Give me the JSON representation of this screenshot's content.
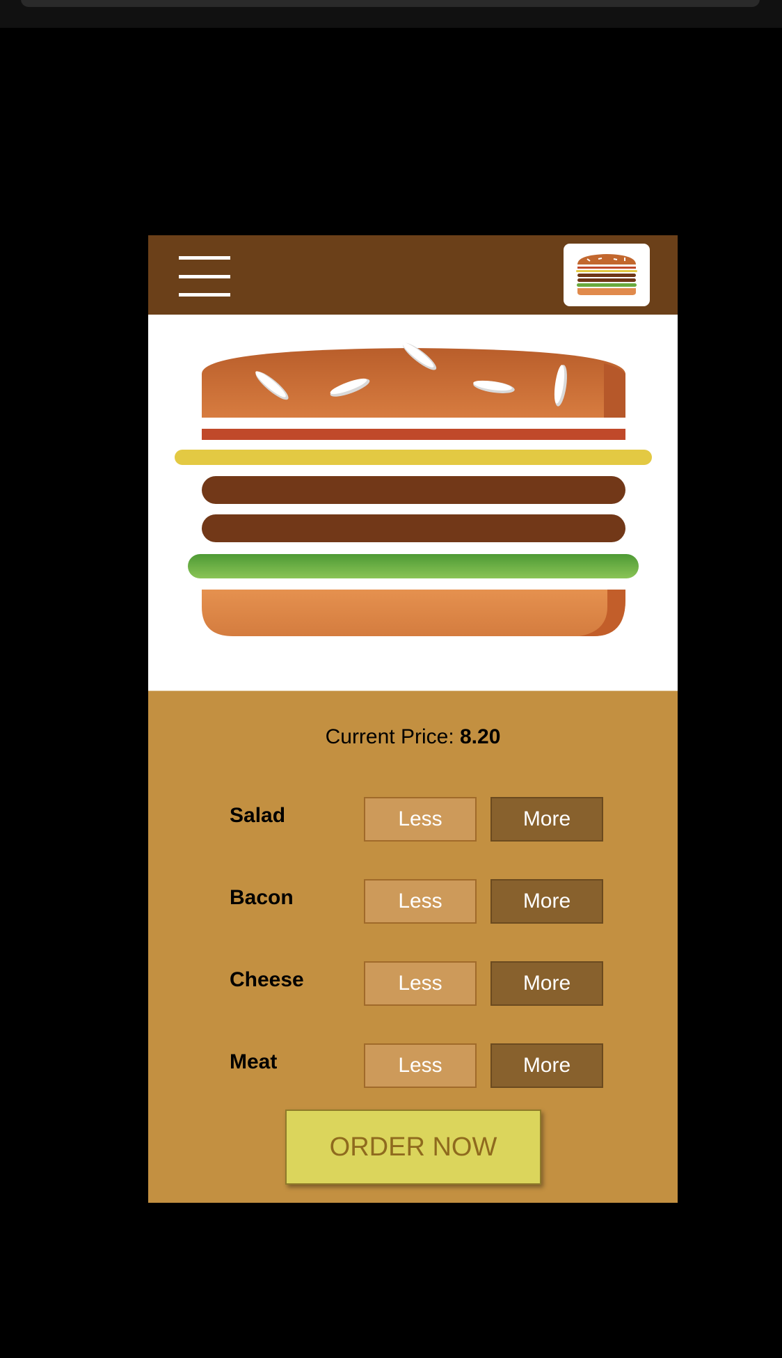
{
  "header": {
    "menu_icon": "hamburger-menu-icon",
    "logo_icon": "burger-logo-icon"
  },
  "hero": {
    "image_icon": "burger-illustration"
  },
  "price": {
    "label": "Current Price:",
    "value": "8.20"
  },
  "ingredients": [
    {
      "name": "Salad",
      "less_label": "Less",
      "more_label": "More"
    },
    {
      "name": "Bacon",
      "less_label": "Less",
      "more_label": "More"
    },
    {
      "name": "Cheese",
      "less_label": "Less",
      "more_label": "More"
    },
    {
      "name": "Meat",
      "less_label": "Less",
      "more_label": "More"
    }
  ],
  "order": {
    "label": "ORDER NOW"
  },
  "colors": {
    "header": "#6b4019",
    "panel": "#c39041",
    "less_button": "#cd9a5a",
    "more_button": "#88612d",
    "order_button": "#dbd55c",
    "order_text": "#8f6a1e"
  }
}
